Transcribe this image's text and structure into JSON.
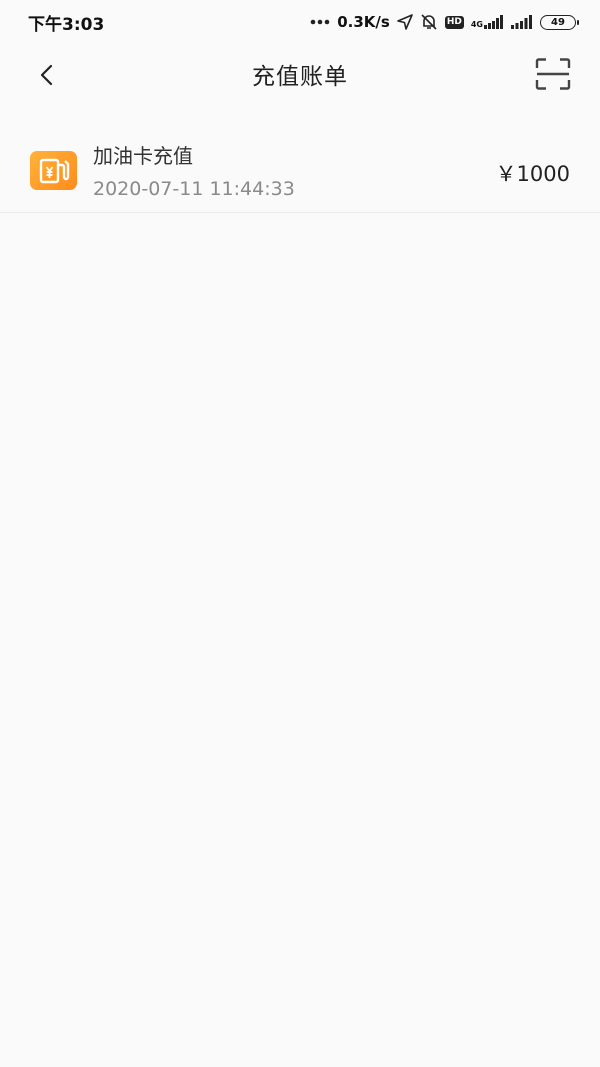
{
  "status_bar": {
    "time": "下午3:03",
    "network_speed": "0.3K/s",
    "hd_label": "HD",
    "network_type": "4G",
    "battery": "49"
  },
  "nav": {
    "title": "充值账单"
  },
  "bills": [
    {
      "name": "加油卡充值",
      "time": "2020-07-11 11:44:33",
      "amount": "￥1000",
      "icon": "fuel-card-icon",
      "icon_color": "#ff9a26"
    }
  ],
  "colors": {
    "background": "#fafafa",
    "accent": "#ff9a26"
  }
}
